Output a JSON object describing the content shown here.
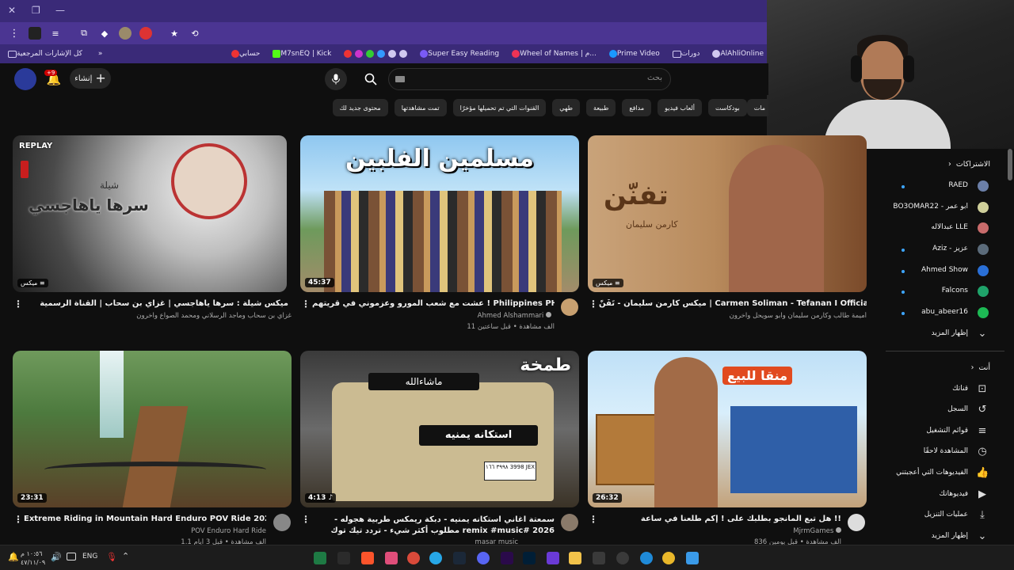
{
  "browser": {
    "bookmarks": [
      "كل الإشارات المرجعية",
      "حسابي",
      "M7snEQ | Kick",
      "Super Easy Reading",
      "Wheel of Names | م...",
      "Prime Video",
      "دورات",
      "AlAhliOnline"
    ]
  },
  "youtube": {
    "create_label": "إنشاء",
    "notification_count": "+9",
    "search_placeholder": "بحث",
    "chips": [
      "محتوى جديد لك",
      "تمت مشاهدتها",
      "القنوات التي تم تحميلها مؤخرًا",
      "طهي",
      "طبيعة",
      "مدافع",
      "ألعاب فيديو",
      "بودكاست",
      "مات"
    ],
    "videos": [
      {
        "title": "ميكس شيلة : سرها ياهاجسي | غزاي بن سحاب | القناة الرسمية",
        "channel": "غزاي بن سحاب وماجد الرسلاني ومحمد الصواع وآخرون",
        "stats": "",
        "badge": "ميكس",
        "thumb_text": "سرها ياهاجسي",
        "thumb_sub": "شيلة",
        "thumb_logo": "REPLAY"
      },
      {
        "title": "عشت مع شعب المورو وعزموني في قريتهم ! Philippines PH",
        "channel": "Ahmed Alshammari",
        "stats": "11 ألف مشاهدة • قبل ساعتين",
        "badge": "45:37",
        "thumb_text": "مسلمين الفلبين"
      },
      {
        "title": "ميكس كارمن سليمان - تَفَنّ | Carmen Soliman - Tefanan I Official Lyric Video",
        "channel": "أميمة طالب وكارمن سليمان وابو سويحل وآخرون",
        "stats": "",
        "badge": "ميكس",
        "thumb_text": "تفنّن",
        "thumb_sub": "كارمن سليمان"
      },
      {
        "title": "Extreme Riding in Mountain Hard Enduro POV Ride 2026",
        "channel": "POV Enduro Hard Ride",
        "stats": "1.1 ألف مشاهدة • قبل 3 أيام",
        "badge": "23:31"
      },
      {
        "title": "سمعتة اغاني استكانه يمنيه - دبكة ريمكس طربية هجوله - مطلوب أكثر شيء - تردد تيك توك remix #music# 2026",
        "channel": "masar music",
        "stats": "",
        "badge": "4:13",
        "thumb_text": "طمخة",
        "thumb_plate": "استكانه يمنيه",
        "thumb_plate_top": "ماشاءالله",
        "thumb_plate_number": "٣٩٩٨ ١٦٦ 3998 JEX"
      },
      {
        "title": "هل تبع المانجو بطلبك على ! إكم طلعنا في ساعة !!",
        "channel": "MjrmGames",
        "stats": "836 ألف مشاهدة • قبل يومين",
        "badge": "26:32",
        "thumb_text": "منقا للبيع"
      }
    ]
  },
  "sidebar": {
    "subscriptions_title": "الاشتراكات",
    "subscriptions": [
      {
        "name": "RAED",
        "color": "#6b7fa8",
        "live": true
      },
      {
        "name": "BO3OMAR22 - ابو عمر",
        "color": "#cfcf9a",
        "live": false
      },
      {
        "name": "عبدالاله LLE",
        "color": "#c86b6b",
        "live": false
      },
      {
        "name": "Aziz - عزيز",
        "color": "#5b6b7a",
        "live": true
      },
      {
        "name": "Ahmed Show",
        "color": "#2a6fd6",
        "live": true
      },
      {
        "name": "Falcons",
        "color": "#1fa36a",
        "live": true
      },
      {
        "name": "abu_abeer16",
        "color": "#1db954",
        "live": true
      }
    ],
    "show_more_label": "إظهار المزيد",
    "you_title": "أنت",
    "you_items": [
      {
        "label": "قناتك",
        "icon": "person-icon"
      },
      {
        "label": "السجل",
        "icon": "history-icon"
      },
      {
        "label": "قوائم التشغيل",
        "icon": "playlist-icon"
      },
      {
        "label": "المشاهدة لاحقًا",
        "icon": "clock-icon"
      },
      {
        "label": "الفيديوهات التي أعجبتني",
        "icon": "thumbs-up-icon"
      },
      {
        "label": "فيديوهاتك",
        "icon": "video-icon"
      },
      {
        "label": "عمليات التنزيل",
        "icon": "download-icon"
      },
      {
        "label": "إظهار المزيد",
        "icon": "chevron-down-icon"
      }
    ]
  },
  "taskbar": {
    "time": "١٠:٥٦ م",
    "date": "٤٧/١١/٠٩",
    "language": "ENG"
  },
  "colors": {
    "browser_frame": "#3a2a78",
    "yt_background": "#0f0f0f",
    "chip_background": "#272727",
    "notification_red": "#cc0000"
  }
}
